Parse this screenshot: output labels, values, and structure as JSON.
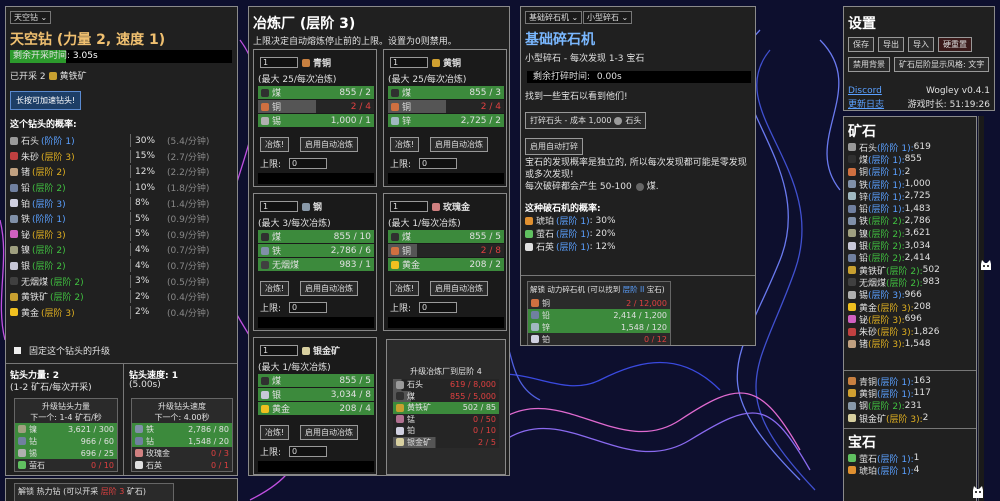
{
  "colors": {
    "accent_green": "#3c8a3c",
    "tier_blue": "#5aa0ff",
    "tier_yellow": "#e0b020",
    "panel_bg": "#202020",
    "title_gold": "#f0c070",
    "title_blue": "#7ab8ff"
  },
  "drill": {
    "select": "天空钻",
    "title": "天空钻 (力量 2, 速度 1)",
    "timer_label": "剩余开采时间:",
    "timer_value": "3.05s",
    "timer_progress": 0.25,
    "mined_prefix": "已开采 2",
    "mined_item": "黄铁矿",
    "boost_button": "长按可加速钻头!",
    "prob_heading": "这个钻头的概率:",
    "probs": [
      {
        "name": "石头",
        "tier": "(阶阶 1)",
        "tier_color": "blue",
        "pct": "30%",
        "rate": "(5.4/分钟)",
        "icon": "#9a9a9a"
      },
      {
        "name": "朱砂",
        "tier": "(层阶 3)",
        "tier_color": "yellow",
        "pct": "15%",
        "rate": "(2.7/分钟)",
        "icon": "#c04040"
      },
      {
        "name": "锗",
        "tier": "(层阶 2)",
        "tier_color": "yellow",
        "pct": "12%",
        "rate": "(2.2/分钟)",
        "icon": "#c0a080"
      },
      {
        "name": "铅",
        "tier": "(层阶 2)",
        "tier_color": "green",
        "pct": "10%",
        "rate": "(1.8/分钟)",
        "icon": "#7080a0"
      },
      {
        "name": "铂",
        "tier": "(层阶 3)",
        "tier_color": "blue",
        "pct": "8%",
        "rate": "(1.4/分钟)",
        "icon": "#d0d0e0"
      },
      {
        "name": "铁",
        "tier": "(阶阶 1)",
        "tier_color": "blue",
        "pct": "5%",
        "rate": "(0.9/分钟)",
        "icon": "#8090a8"
      },
      {
        "name": "铋",
        "tier": "(层阶 3)",
        "tier_color": "yellow",
        "pct": "5%",
        "rate": "(0.9/分钟)",
        "icon": "#d060c0"
      },
      {
        "name": "镍",
        "tier": "(层阶 2)",
        "tier_color": "green",
        "pct": "4%",
        "rate": "(0.7/分钟)",
        "icon": "#a0a080"
      },
      {
        "name": "银",
        "tier": "(层阶 2)",
        "tier_color": "green",
        "pct": "4%",
        "rate": "(0.7/分钟)",
        "icon": "#c8c8d8"
      },
      {
        "name": "无烟煤",
        "tier": "(层阶 2)",
        "tier_color": "green",
        "pct": "3%",
        "rate": "(0.5/分钟)",
        "icon": "#404040"
      },
      {
        "name": "黄铁矿",
        "tier": "(层阶 2)",
        "tier_color": "green",
        "pct": "2%",
        "rate": "(0.4/分钟)",
        "icon": "#c8a030"
      },
      {
        "name": "黄金",
        "tier": "(层阶 3)",
        "tier_color": "yellow",
        "pct": "2%",
        "rate": "(0.4/分钟)",
        "icon": "#f0c020"
      }
    ],
    "lock_label": "固定这个钻头的升级",
    "power_title": "钻头力量: 2",
    "power_sub": "(1-2 矿石/每次开采)",
    "speed_title": "钻头速度: 1",
    "speed_sub": "(5.00s)",
    "power_up": {
      "title": "升级钻头力量",
      "sub": "下一个: 1-4 矿石/秒",
      "rows": [
        {
          "name": "镍",
          "v": "3,621 / 300",
          "icon": "#a0a080",
          "done": true
        },
        {
          "name": "钻",
          "v": "966 / 60",
          "icon": "#7080a0",
          "done": true
        },
        {
          "name": "锡",
          "v": "696 / 25",
          "icon": "#b0b0b0",
          "done": true
        },
        {
          "name": "萤石",
          "v": "0 / 10",
          "icon": "#60c060",
          "done": false
        }
      ]
    },
    "speed_up": {
      "title": "升级钻头速度",
      "sub": "下一个: 4.00秒",
      "rows": [
        {
          "name": "铁",
          "v": "2,786 / 80",
          "icon": "#8090a8",
          "done": true
        },
        {
          "name": "钻",
          "v": "1,548 / 20",
          "icon": "#7080a0",
          "done": true
        },
        {
          "name": "玫瑰金",
          "v": "0 / 3",
          "icon": "#d08080",
          "done": false
        },
        {
          "name": "石英",
          "v": "0 / 1",
          "icon": "#e0e0e0",
          "done": false
        }
      ]
    },
    "unlock_label": "解锁 热力钻 (可以开采 ",
    "unlock_hl": "层阶 3",
    "unlock_tail": " 矿石)"
  },
  "smelter": {
    "title": "冶炼厂 (层阶 3)",
    "desc": "上限决定自动熔炼停止前的上限。设置为0则禁用。",
    "smelt_btn": "冶炼!",
    "auto_btn": "启用自动冶炼",
    "limit_label": "上限:",
    "cards": [
      {
        "qty": "1",
        "name": "青铜",
        "icon": "#c88040",
        "rate": "(最大 25/每次冶炼)",
        "limit": "0",
        "rows": [
          {
            "name": "煤",
            "v": "855 / 2",
            "icon": "#303030",
            "fill": 1
          },
          {
            "name": "铜",
            "v": "2 / 4",
            "icon": "#d07040",
            "fill": 0.5,
            "red": true
          },
          {
            "name": "锡",
            "v": "1,000 / 1",
            "icon": "#b0b0b0",
            "fill": 1
          }
        ]
      },
      {
        "qty": "1",
        "name": "黄铜",
        "icon": "#d0a030",
        "rate": "(最大 25/每次冶炼)",
        "limit": "0",
        "rows": [
          {
            "name": "煤",
            "v": "855 / 3",
            "icon": "#303030",
            "fill": 1
          },
          {
            "name": "铜",
            "v": "2 / 4",
            "icon": "#d07040",
            "fill": 0.5,
            "red": true
          },
          {
            "name": "锌",
            "v": "2,725 / 2",
            "icon": "#a0b8c0",
            "fill": 1
          }
        ]
      },
      {
        "qty": "1",
        "name": "钢",
        "icon": "#8898a8",
        "rate": "(最大 3/每次冶炼)",
        "limit": "0",
        "rows": [
          {
            "name": "煤",
            "v": "855 / 10",
            "icon": "#303030",
            "fill": 1
          },
          {
            "name": "铁",
            "v": "2,786 / 6",
            "icon": "#8090a8",
            "fill": 1
          },
          {
            "name": "无烟煤",
            "v": "983 / 1",
            "icon": "#404040",
            "fill": 1
          }
        ]
      },
      {
        "qty": "1",
        "name": "玫瑰金",
        "icon": "#d08080",
        "rate": "(最大 1/每次冶炼)",
        "limit": "0",
        "rows": [
          {
            "name": "煤",
            "v": "855 / 5",
            "icon": "#303030",
            "fill": 1
          },
          {
            "name": "铜",
            "v": "2 / 8",
            "icon": "#d07040",
            "fill": 0.25,
            "red": true
          },
          {
            "name": "黄金",
            "v": "208 / 2",
            "icon": "#f0c020",
            "fill": 1
          }
        ]
      },
      {
        "qty": "1",
        "name": "银金矿",
        "icon": "#d8d0a0",
        "rate": "(最大 1/每次冶炼)",
        "limit": "0",
        "rows": [
          {
            "name": "煤",
            "v": "855 / 5",
            "icon": "#303030",
            "fill": 1
          },
          {
            "name": "银",
            "v": "3,034 / 8",
            "icon": "#c8c8d8",
            "fill": 1
          },
          {
            "name": "黄金",
            "v": "208 / 4",
            "icon": "#f0c020",
            "fill": 1
          }
        ]
      }
    ],
    "upgrade": {
      "title": "升级冶炼厂到层阶 4",
      "rows": [
        {
          "name": "石头",
          "v": "619 / 8,000",
          "icon": "#9a9a9a",
          "fill": 0.08,
          "red": true
        },
        {
          "name": "煤",
          "v": "855 / 5,000",
          "icon": "#303030",
          "fill": 0.17,
          "red": true
        },
        {
          "name": "黄铁矿",
          "v": "502 / 85",
          "icon": "#c8a030",
          "fill": 1
        },
        {
          "name": "锰",
          "v": "0 / 50",
          "icon": "#b07090",
          "fill": 0,
          "red": true
        },
        {
          "name": "铂",
          "v": "0 / 10",
          "icon": "#d0d0e0",
          "fill": 0,
          "red": true
        },
        {
          "name": "银金矿",
          "v": "2 / 5",
          "icon": "#d8d0a0",
          "fill": 0.4,
          "red": true
        }
      ]
    }
  },
  "crusher": {
    "select1": "基础碎石机",
    "select2": "小型碎石",
    "title": "基础碎石机",
    "sub": "小型碎石 - 每次发现 1-3 宝石",
    "timer_label": "剩余打碎时间:",
    "timer_value": "0.00s",
    "hint": "找到一些宝石以看到他们!",
    "crush_btn": "打碎石头 - 成本 1,000",
    "crush_icon_label": "石头",
    "auto_btn": "启用自动打碎",
    "desc1": "宝石的发现概率是独立的, 所以每次发现都可能是零发现或多次发现!",
    "desc2": "每次破碎都会产生 50-100",
    "desc2_tail": "煤.",
    "prob_heading": "这种破石机的概率:",
    "probs": [
      {
        "name": "琥珀",
        "tier": "(层阶 1)",
        "pct": "30%",
        "icon": "#e09030"
      },
      {
        "name": "萤石",
        "tier": "(层阶 1)",
        "pct": "20%",
        "icon": "#60c060"
      },
      {
        "name": "石英",
        "tier": "(层阶 1)",
        "pct": "12%",
        "icon": "#e0e0e0"
      }
    ],
    "unlock": {
      "title_pre": "解锁 动力碎石机 (可以找到 ",
      "title_hl": "层阶 II",
      "title_tail": " 宝石)",
      "rows": [
        {
          "name": "铜",
          "v": "2 / 12,000",
          "icon": "#d07040",
          "done": false
        },
        {
          "name": "铅",
          "v": "2,414 / 1,200",
          "icon": "#7080a0",
          "done": true
        },
        {
          "name": "锌",
          "v": "1,548 / 120",
          "icon": "#a0b8c0",
          "done": true
        },
        {
          "name": "铂",
          "v": "0 / 12",
          "icon": "#d0d0e0",
          "done": false
        }
      ]
    }
  },
  "settings": {
    "title": "设置",
    "buttons": [
      "保存",
      "导出",
      "导入",
      "硬重置"
    ],
    "btn_bg": "禁用背景",
    "btn_style": "矿石层阶显示风格: 文字",
    "discord": "Discord",
    "changelog": "更新日志",
    "version": "Wogley v0.4.1",
    "time_label": "游戏时长:",
    "time_value": "51:19:26"
  },
  "inventory": {
    "ore_title": "矿石",
    "ores": [
      {
        "name": "石头",
        "tier": "(阶阶 1):",
        "tc": "blue",
        "v": "619",
        "icon": "#9a9a9a"
      },
      {
        "name": "煤",
        "tier": "(层阶 1):",
        "tc": "blue",
        "v": "855",
        "icon": "#303030"
      },
      {
        "name": "铜",
        "tier": "(层阶 1):",
        "tc": "blue",
        "v": "2",
        "icon": "#d07040"
      },
      {
        "name": "铁",
        "tier": "(层阶 1):",
        "tc": "blue",
        "v": "1,000",
        "icon": "#8090a8"
      },
      {
        "name": "锌",
        "tier": "(层阶 1):",
        "tc": "blue",
        "v": "2,725",
        "icon": "#a0b8c0"
      },
      {
        "name": "铅",
        "tier": "(层阶 1):",
        "tc": "blue",
        "v": "1,483",
        "icon": "#7080a0"
      },
      {
        "name": "铁",
        "tier": "(层阶 2):",
        "tc": "green",
        "v": "2,786",
        "icon": "#8090a8"
      },
      {
        "name": "镍",
        "tier": "(层阶 2):",
        "tc": "green",
        "v": "3,621",
        "icon": "#a0a080"
      },
      {
        "name": "银",
        "tier": "(层阶 2):",
        "tc": "green",
        "v": "3,034",
        "icon": "#c8c8d8"
      },
      {
        "name": "铅",
        "tier": "(层阶 2):",
        "tc": "green",
        "v": "2,414",
        "icon": "#7080a0"
      },
      {
        "name": "黄铁矿",
        "tier": "(层阶 2):",
        "tc": "green",
        "v": "502",
        "icon": "#c8a030"
      },
      {
        "name": "无烟煤",
        "tier": "(层阶 2):",
        "tc": "green",
        "v": "983",
        "icon": "#404040"
      },
      {
        "name": "锡",
        "tier": "(层阶 3):",
        "tc": "blue",
        "v": "966",
        "icon": "#b0b0b0"
      },
      {
        "name": "黄金",
        "tier": "(层阶 3):",
        "tc": "yellow",
        "v": "208",
        "icon": "#f0c020"
      },
      {
        "name": "铋",
        "tier": "(层阶 3):",
        "tc": "yellow",
        "v": "696",
        "icon": "#d060c0"
      },
      {
        "name": "朱砂",
        "tier": "(层阶 3):",
        "tc": "yellow",
        "v": "1,826",
        "icon": "#c04040"
      },
      {
        "name": "锗",
        "tier": "(层阶 3):",
        "tc": "yellow",
        "v": "1,548",
        "icon": "#c0a080"
      }
    ],
    "alloys": [
      {
        "name": "青铜",
        "tier": "(层阶 1):",
        "tc": "blue",
        "v": "163",
        "icon": "#c88040"
      },
      {
        "name": "黄铜",
        "tier": "(层阶 1):",
        "tc": "blue",
        "v": "117",
        "icon": "#d0a030"
      },
      {
        "name": "钢",
        "tier": "(层阶 2):",
        "tc": "green",
        "v": "231",
        "icon": "#8898a8"
      },
      {
        "name": "银金矿",
        "tier": "(层阶 3):",
        "tc": "yellow",
        "v": "2",
        "icon": "#d8d0a0"
      }
    ],
    "gem_title": "宝石",
    "gems": [
      {
        "name": "萤石",
        "tier": "(层阶 1):",
        "tc": "blue",
        "v": "1",
        "icon": "#60c060"
      },
      {
        "name": "琥珀",
        "tier": "(层阶 1):",
        "tc": "blue",
        "v": "4",
        "icon": "#e09030"
      }
    ]
  }
}
